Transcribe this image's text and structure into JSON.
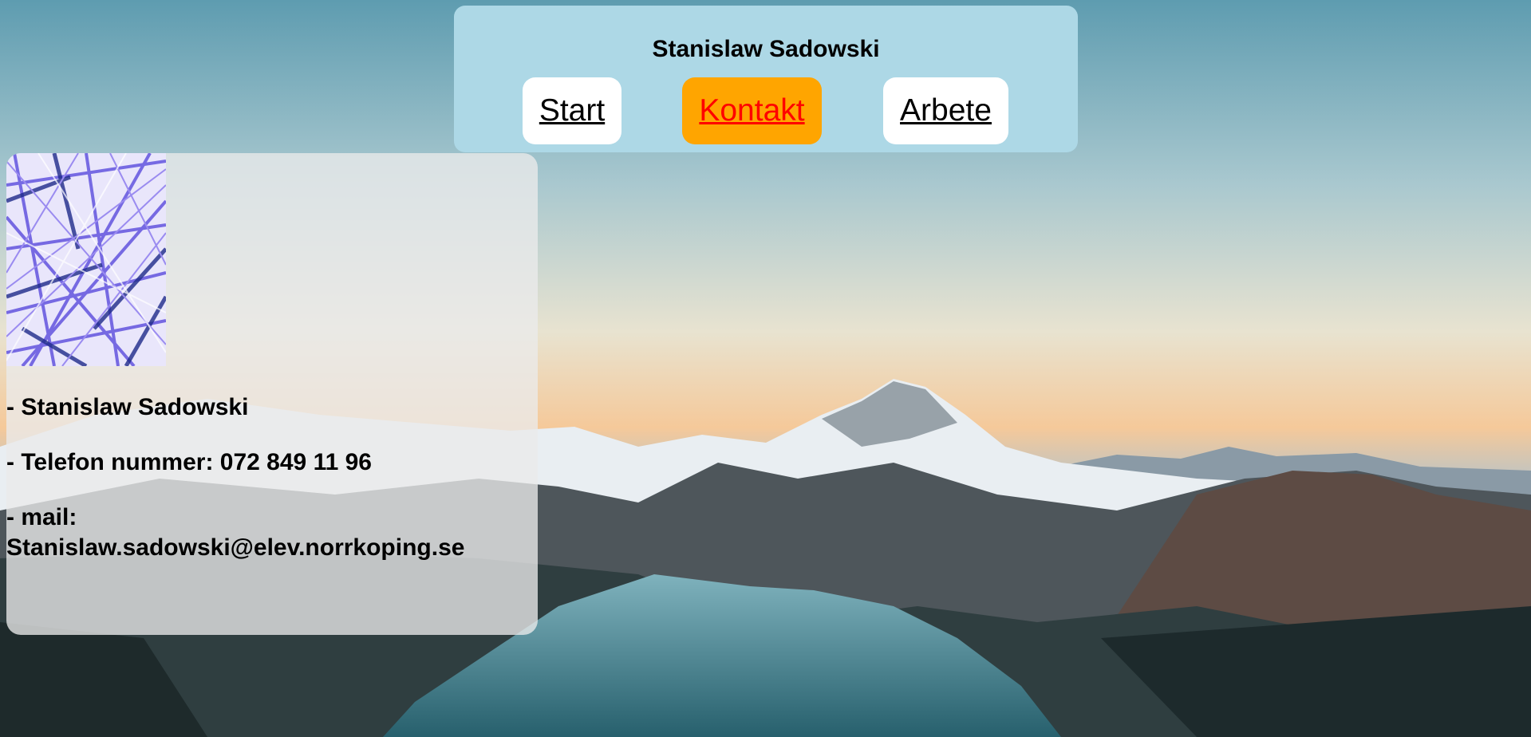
{
  "header": {
    "title": "Stanislaw Sadowski",
    "nav": [
      {
        "label": "Start",
        "active": false
      },
      {
        "label": "Kontakt",
        "active": true
      },
      {
        "label": "Arbete",
        "active": false
      }
    ]
  },
  "contact": {
    "name": "- Stanislaw Sadowski",
    "phone": "- Telefon nummer: 072 849 11 96",
    "mail_label": "- mail:",
    "mail": "Stanislaw.sadowski@elev.norrkoping.se"
  },
  "colors": {
    "header_bg": "#add8e6",
    "nav_active_bg": "#ffa500",
    "nav_active_text": "#ff0000",
    "nav_bg": "#ffffff"
  }
}
